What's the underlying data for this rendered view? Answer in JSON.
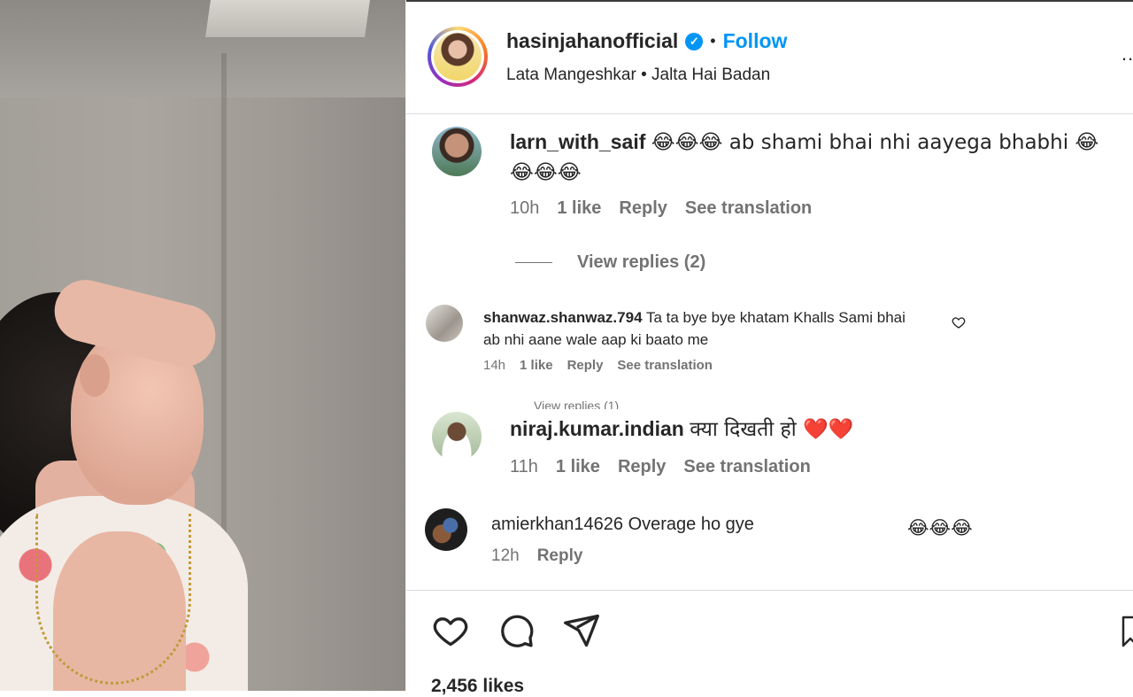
{
  "post": {
    "username": "hasinjahanofficial",
    "follow_label": "Follow",
    "separator": "•",
    "audio": "Lata Mangeshkar • Jalta Hai Badan",
    "more_label": "..."
  },
  "comments": [
    {
      "username": "larn_with_saif",
      "text_line1": "😂😂😂 ab shami bhai nhi aayega bhabhi 😂",
      "text_line2": "😂😂😂",
      "time": "10h",
      "likes": "1 like",
      "reply_label": "Reply",
      "translation_label": "See translation",
      "view_replies": "View replies (2)"
    },
    {
      "username": "shanwaz.shanwaz.794",
      "text": "Ta ta bye bye khatam Khalls Sami bhai ab nhi aane wale aap ki baato me",
      "time": "14h",
      "likes": "1 like",
      "reply_label": "Reply",
      "translation_label": "See translation",
      "view_replies": "View replies (1)"
    },
    {
      "username": "niraj.kumar.indian",
      "text": "क्या दिखती हो ❤️❤️",
      "time": "11h",
      "likes": "1 like",
      "reply_label": "Reply",
      "translation_label": "See translation"
    },
    {
      "username": "amierkhan14626",
      "text": "Overage ho gye",
      "emoji_trail": "😂😂😂",
      "time": "12h",
      "reply_label": "Reply"
    }
  ],
  "footer": {
    "likes_count": "2,456 likes"
  },
  "icons": [
    "heart-icon",
    "comment-icon",
    "share-icon",
    "bookmark-icon",
    "verified-icon",
    "more-icon"
  ],
  "colors": {
    "accent": "#0095f6",
    "text": "#262626",
    "muted": "#737373",
    "heart": "#ed4956"
  }
}
